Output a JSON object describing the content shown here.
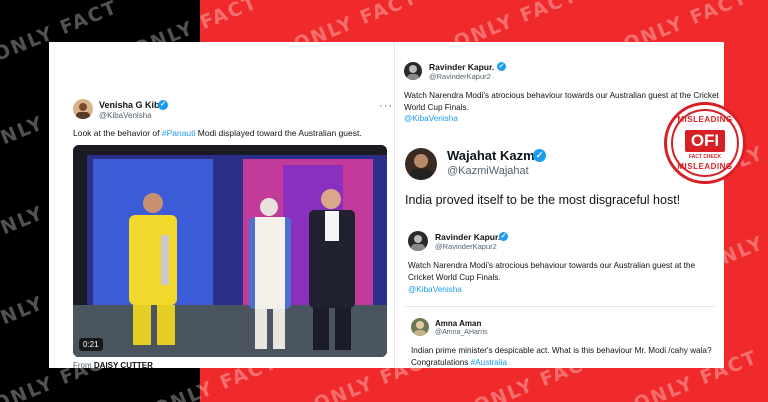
{
  "watermark": "ONLY FACT",
  "tweet_left": {
    "name": "Venisha G Kiba",
    "handle": "@KibaVenisha",
    "text_before": "Look at the behavior of ",
    "hashtag": "#Panauti",
    "text_after": " Modi displayed toward the Australian guest.",
    "video_duration": "0:21",
    "from_label": "From",
    "from_source": "DAISY CUTTER"
  },
  "tweet_ravinder_top": {
    "name": "Ravinder Kapur.",
    "handle": "@RavinderKapur2",
    "text": "Watch Narendra Modi's atrocious behaviour towards our Australian guest at the Cricket World Cup Finals.",
    "mention": "@KibaVenisha"
  },
  "tweet_wajahat": {
    "name": "Wajahat Kazmi",
    "handle": "@KazmiWajahat",
    "text": "India proved itself to be the most disgraceful host!"
  },
  "tweet_ravinder_quoted": {
    "name": "Ravinder Kapur.",
    "handle": "@RavinderKapur2",
    "text": "Watch Narendra Modi's atrocious behaviour towards our Australian guest at the Cricket World Cup Finals.",
    "mention": "@KibaVenisha"
  },
  "tweet_amna": {
    "name": "Amna Aman",
    "handle": "@Amna_AHarris",
    "text": "Indian prime minister's despicable act. What is this behaviour Mr. Modi /cahy wala? Congratulations ",
    "hashtag": "#Australia"
  },
  "stamp": {
    "top": "MISLEADING",
    "logo": "OFI",
    "sub": "FACT CHECK",
    "bottom": "MISLEADING"
  },
  "more_icon": "ellipsis-icon",
  "colors": {
    "red": "#f02a2a",
    "link": "#1d9bf0",
    "stamp": "#d81f26"
  }
}
